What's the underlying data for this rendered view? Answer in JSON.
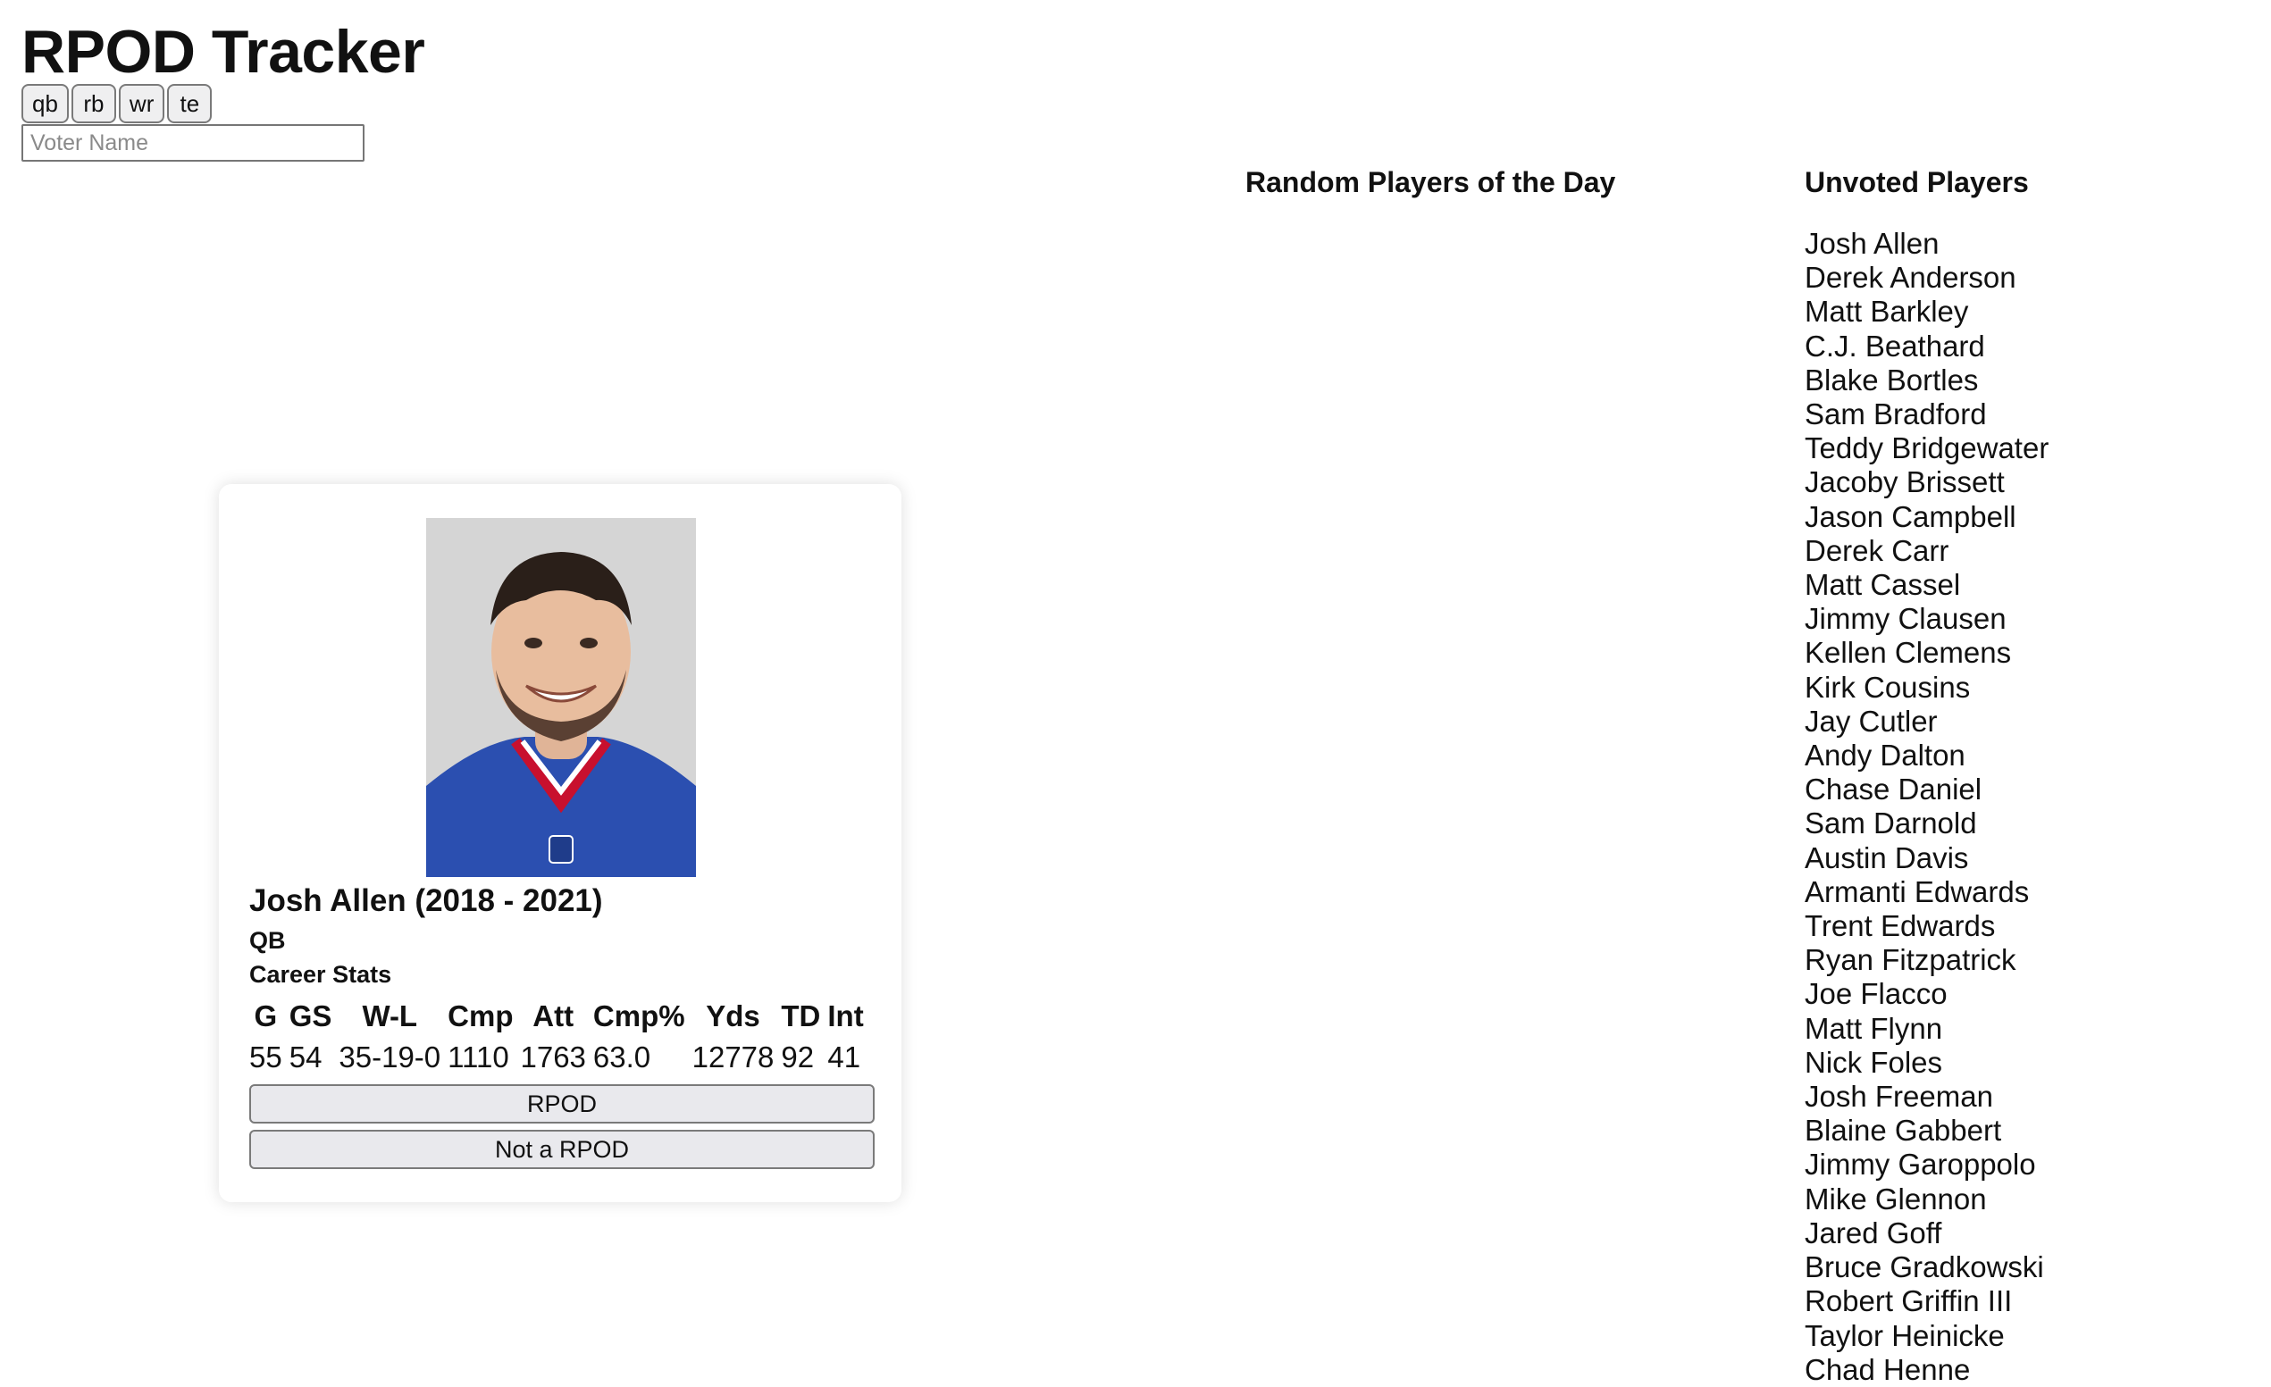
{
  "app": {
    "title": "RPOD Tracker"
  },
  "positions": [
    "qb",
    "rb",
    "wr",
    "te"
  ],
  "voter": {
    "placeholder": "Voter Name",
    "value": ""
  },
  "headings": {
    "rpod": "Random Players of the Day",
    "unvoted": "Unvoted Players"
  },
  "card": {
    "name": "Josh Allen (2018 - 2021)",
    "position": "QB",
    "stats_label": "Career Stats",
    "stat_headers": [
      "G",
      "GS",
      "W-L",
      "Cmp",
      "Att",
      "Cmp%",
      "Yds",
      "TD",
      "Int"
    ],
    "stat_values": [
      "55",
      "54",
      "35-19-0",
      "1110",
      "1763",
      "63.0",
      "12778",
      "92",
      "41"
    ],
    "rpod_label": "RPOD",
    "not_rpod_label": "Not a RPOD",
    "colors": {
      "jersey": "#2b4fb0",
      "collar": "#c8102e"
    }
  },
  "unvoted_players": [
    "Josh Allen",
    "Derek Anderson",
    "Matt Barkley",
    "C.J. Beathard",
    "Blake Bortles",
    "Sam Bradford",
    "Teddy Bridgewater",
    "Jacoby Brissett",
    "Jason Campbell",
    "Derek Carr",
    "Matt Cassel",
    "Jimmy Clausen",
    "Kellen Clemens",
    "Kirk Cousins",
    "Jay Cutler",
    "Andy Dalton",
    "Chase Daniel",
    "Sam Darnold",
    "Austin Davis",
    "Armanti Edwards",
    "Trent Edwards",
    "Ryan Fitzpatrick",
    "Joe Flacco",
    "Matt Flynn",
    "Nick Foles",
    "Josh Freeman",
    "Blaine Gabbert",
    "Jimmy Garoppolo",
    "Mike Glennon",
    "Jared Goff",
    "Bruce Gradkowski",
    "Robert Griffin III",
    "Taylor Heinicke",
    "Chad Henne"
  ]
}
